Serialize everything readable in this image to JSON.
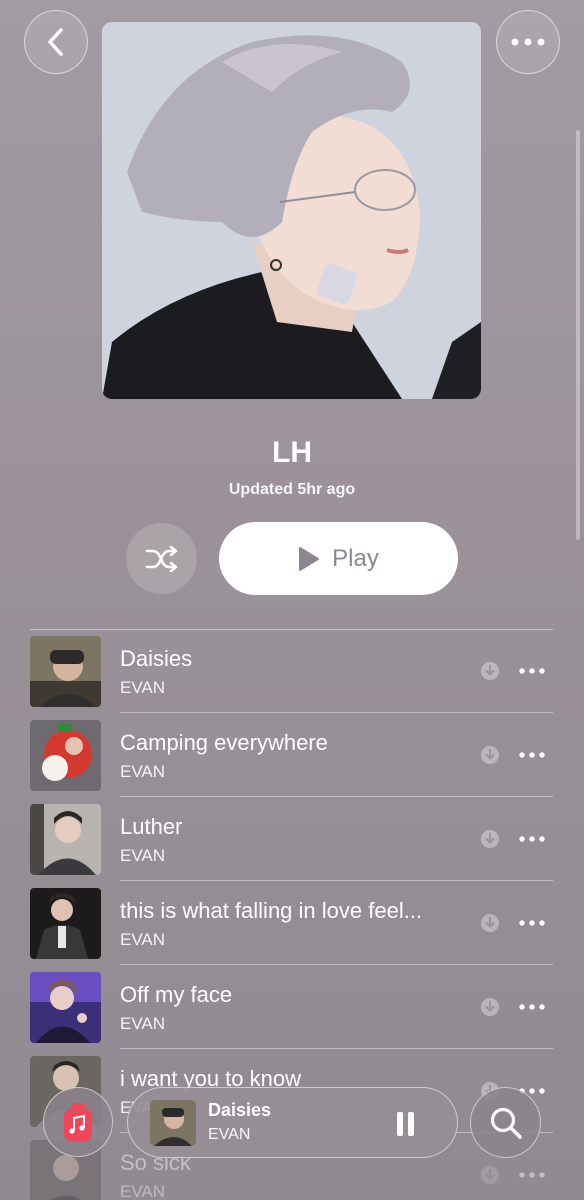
{
  "header": {
    "back_icon": "chevron-left-icon",
    "more_icon": "ellipsis-icon"
  },
  "playlist": {
    "title": "LH",
    "updated": "Updated 5hr ago",
    "play_label": "Play",
    "shuffle_icon": "shuffle-icon"
  },
  "tracks": [
    {
      "title": "Daisies",
      "artist": "EVAN"
    },
    {
      "title": "Camping everywhere",
      "artist": "EVAN"
    },
    {
      "title": "Luther",
      "artist": "EVAN"
    },
    {
      "title": "this is what falling in love feel...",
      "artist": "EVAN"
    },
    {
      "title": "Off my face",
      "artist": "EVAN"
    },
    {
      "title": "i want you to know",
      "artist": "EVAN"
    },
    {
      "title": "So sick",
      "artist": "EVAN"
    }
  ],
  "now_playing": {
    "title": "Daisies",
    "artist": "EVAN"
  },
  "colors": {
    "background": "#9b9399",
    "accent_music": "#f0465c",
    "play_text": "#8d8690"
  }
}
